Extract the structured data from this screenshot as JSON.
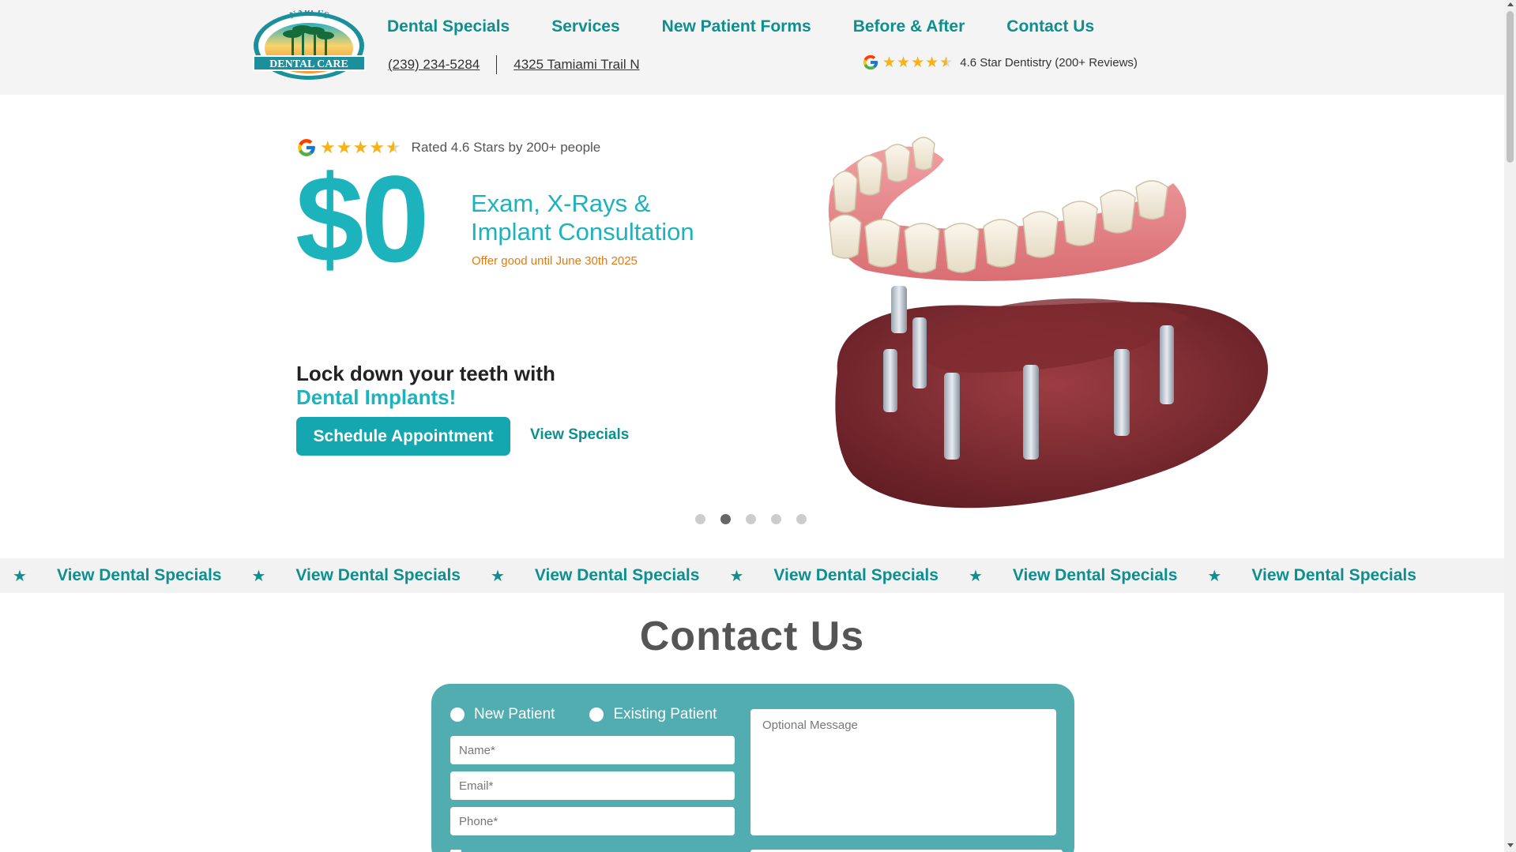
{
  "brand": {
    "logo_arc_text": "NAPLES",
    "logo_banner_text": "DENTAL CARE",
    "colors": {
      "teal": "#1cb3bd",
      "teal_dark": "#0e8f8f",
      "orange": "#e07b12",
      "star": "#f5b21a",
      "form_bg": "#52adb0"
    }
  },
  "nav": {
    "items": [
      {
        "label": "Dental Specials"
      },
      {
        "label": "Services"
      },
      {
        "label": "New Patient Forms"
      },
      {
        "label": "Before & After"
      },
      {
        "label": "Contact Us"
      }
    ]
  },
  "header": {
    "phone": "(239) 234-5284",
    "address": "4325 Tamiami Trail N",
    "rating_text": "4.6 Star Dentistry (200+ Reviews)",
    "rating_value": 4.6
  },
  "hero": {
    "rating_text": "Rated 4.6 Stars by 200+ people",
    "price": "$0",
    "offer_line1": "Exam, X-Rays &",
    "offer_line2": "Implant Consultation",
    "offer_note": "Offer good until June 30th 2025",
    "headline": "Lock down your teeth with",
    "headline_accent": "Dental Implants!",
    "primary_button": "Schedule Appointment",
    "secondary_link": "View Specials",
    "slides_total": 5,
    "slide_active": 2,
    "image_icon": "dental-implant-illustration"
  },
  "ticker": {
    "star_glyph": "★",
    "items": [
      "View Dental Specials",
      "View Dental Specials",
      "View Dental Specials",
      "View Dental Specials",
      "View Dental Specials",
      "View Dental Specials"
    ]
  },
  "contact": {
    "title": "Contact Us",
    "radio_new": "New Patient",
    "radio_existing": "Existing Patient",
    "name_placeholder": "Name*",
    "email_placeholder": "Email*",
    "phone_placeholder": "Phone*",
    "message_placeholder": "Optional Message"
  }
}
